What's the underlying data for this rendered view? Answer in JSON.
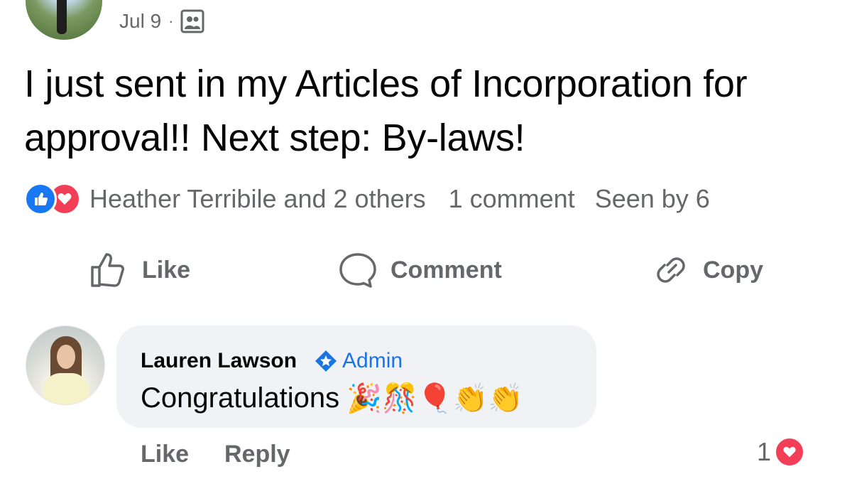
{
  "post": {
    "date": "Jul 9",
    "separator": "·",
    "audience_icon": "group-icon",
    "text": "I just sent in my Articles of Incorporation for approval!! Next step: By-laws!",
    "reactions": {
      "icons": [
        "like-icon",
        "love-icon"
      ],
      "reactors": "Heather Terribile and 2 others",
      "comment_count": "1 comment",
      "seen_by": "Seen by 6"
    }
  },
  "actions": {
    "like": "Like",
    "comment": "Comment",
    "copy": "Copy"
  },
  "comment": {
    "author": "Lauren Lawson",
    "badge": "Admin",
    "text": "Congratulations",
    "emojis": "🎉🎊🎈👏👏",
    "like_label": "Like",
    "reply_label": "Reply",
    "reaction_count": "1",
    "reaction_icon": "love-icon"
  },
  "colors": {
    "like_blue": "#1877f2",
    "love_red": "#f33e58",
    "admin_blue": "#1b74e4",
    "muted_text": "#65676b",
    "bubble_bg": "#f0f2f5"
  }
}
